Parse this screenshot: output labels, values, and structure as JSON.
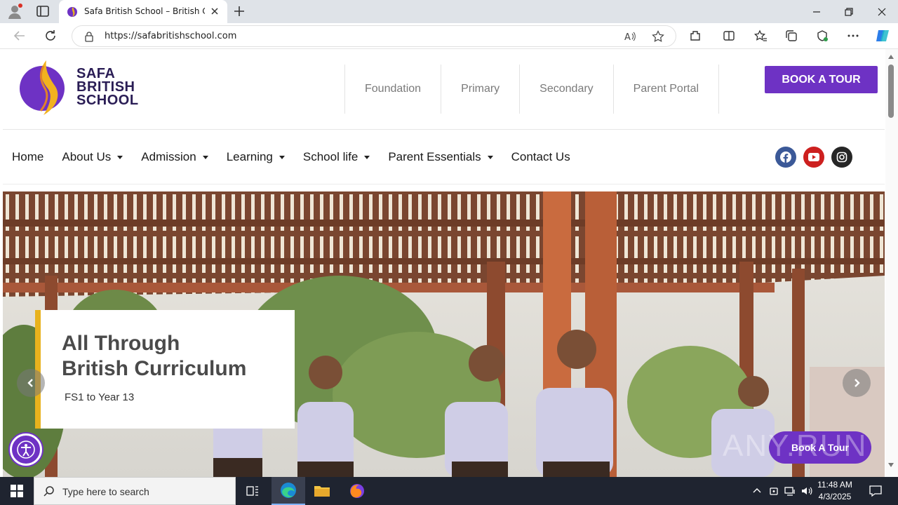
{
  "browser": {
    "tab_title": "Safa British School – British Curri",
    "url": "https://safabritishschool.com"
  },
  "site": {
    "logo_lines": [
      "SAFA",
      "BRITISH",
      "SCHOOL"
    ],
    "top_links": [
      "Foundation",
      "Primary",
      "Secondary",
      "Parent Portal"
    ],
    "book_tour": "BOOK A TOUR",
    "menu": [
      {
        "label": "Home",
        "dropdown": false
      },
      {
        "label": "About Us",
        "dropdown": true
      },
      {
        "label": "Admission",
        "dropdown": true
      },
      {
        "label": "Learning",
        "dropdown": true
      },
      {
        "label": "School life",
        "dropdown": true
      },
      {
        "label": "Parent Essentials",
        "dropdown": true
      },
      {
        "label": "Contact Us",
        "dropdown": false
      }
    ],
    "social": [
      "facebook-icon",
      "youtube-icon",
      "instagram-icon"
    ]
  },
  "hero": {
    "title_line1": "All Through",
    "title_line2": "British Curriculum",
    "subtitle": "FS1 to Year 13",
    "float_button": "Book A Tour"
  },
  "watermark": "ANY.RUN",
  "taskbar": {
    "search_placeholder": "Type here to search",
    "time": "11:48 AM",
    "date": "4/3/2025"
  },
  "colors": {
    "brand_purple": "#6e32c4",
    "brand_gold": "#e8b21d",
    "logo_navy": "#2a1d55"
  }
}
